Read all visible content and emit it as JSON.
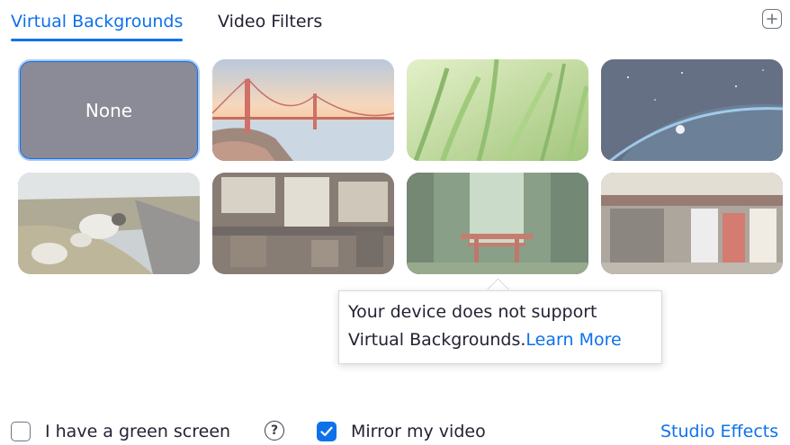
{
  "tabs": {
    "virtual_backgrounds": "Virtual Backgrounds",
    "video_filters": "Video Filters"
  },
  "add_button": {
    "icon": "plus-icon"
  },
  "backgrounds": {
    "none_label": "None",
    "items": [
      {
        "name": "golden-gate"
      },
      {
        "name": "grass"
      },
      {
        "name": "earth-space"
      },
      {
        "name": "sheep-road"
      },
      {
        "name": "cafe"
      },
      {
        "name": "torii-forest"
      },
      {
        "name": "japanese-shop"
      }
    ]
  },
  "tooltip": {
    "line1": "Your device does not support",
    "line2": "Virtual Backgrounds.",
    "learn_more": "Learn More"
  },
  "options": {
    "green_screen_label": "I have a green screen",
    "green_screen_checked": false,
    "mirror_label": "Mirror my video",
    "mirror_checked": true,
    "studio_effects": "Studio Effects"
  },
  "colors": {
    "accent": "#0e71eb",
    "text": "#232333",
    "none_tile": "#8a8b96"
  }
}
